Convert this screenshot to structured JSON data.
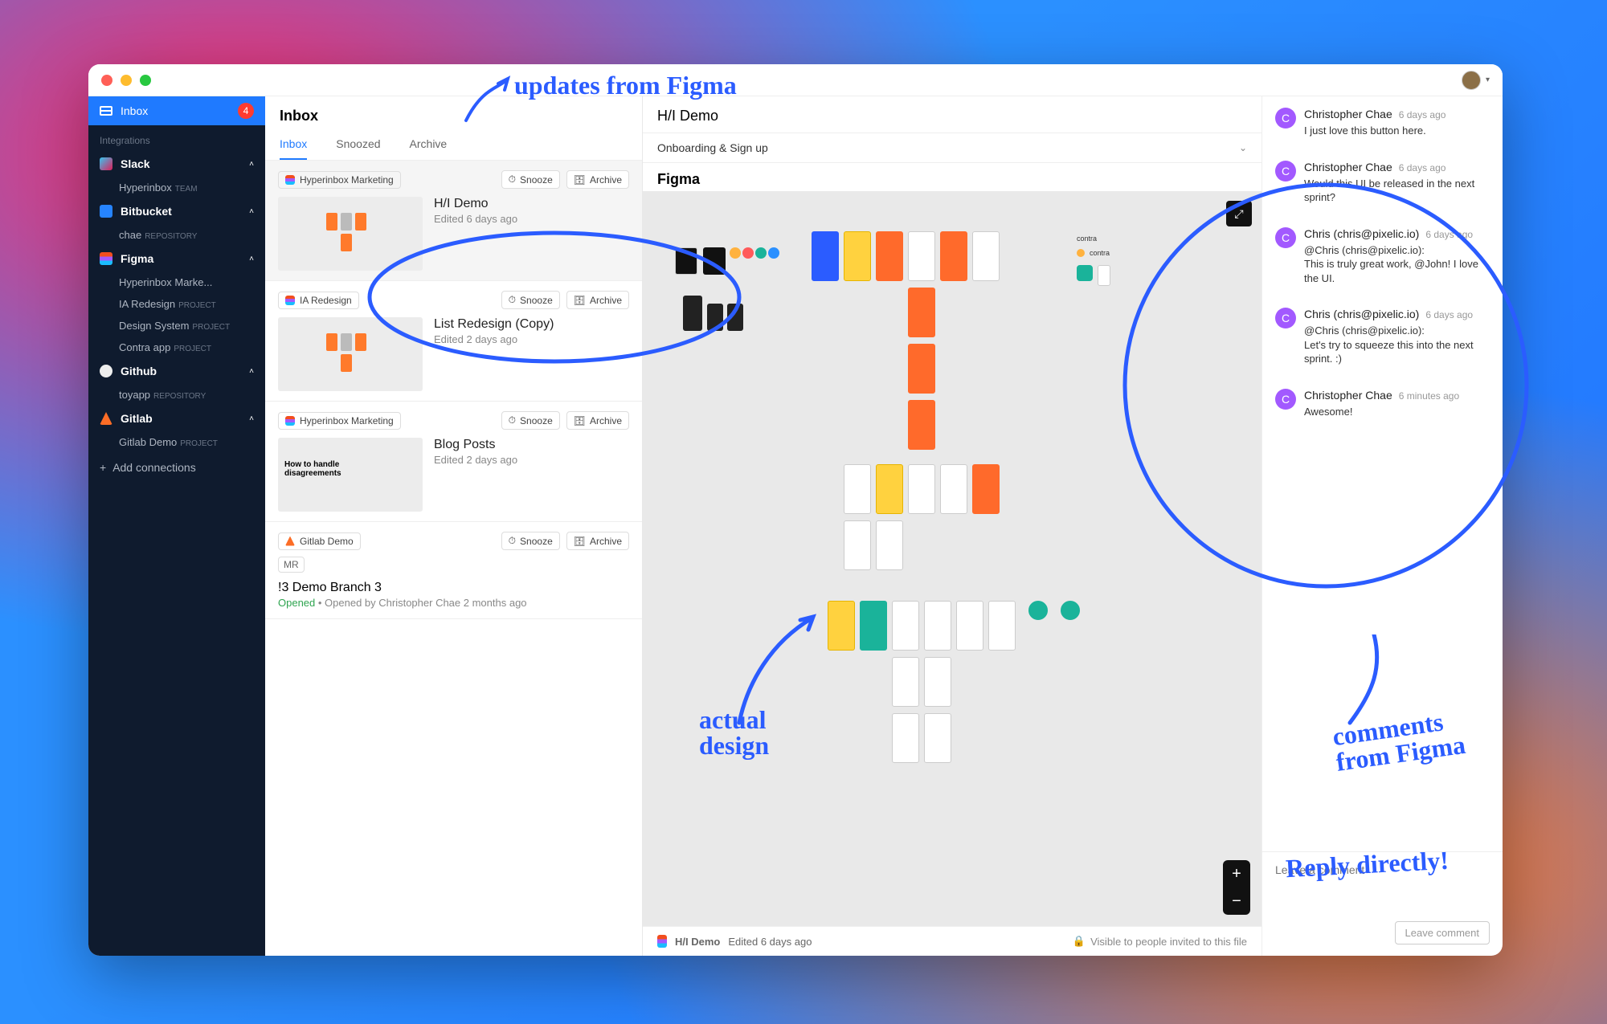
{
  "titlebar": {
    "avatar_caret": "▾"
  },
  "sidebar": {
    "inbox_label": "Inbox",
    "inbox_badge": "4",
    "integrations_label": "Integrations",
    "groups": [
      {
        "icon": "slack",
        "name": "Slack",
        "subs": [
          {
            "label": "Hyperinbox",
            "tag": "TEAM"
          }
        ]
      },
      {
        "icon": "bb",
        "name": "Bitbucket",
        "subs": [
          {
            "label": "chae",
            "tag": "REPOSITORY"
          }
        ]
      },
      {
        "icon": "figma",
        "name": "Figma",
        "subs": [
          {
            "label": "Hyperinbox Marke...",
            "tag": ""
          },
          {
            "label": "IA Redesign",
            "tag": "PROJECT"
          },
          {
            "label": "Design System",
            "tag": "PROJECT"
          },
          {
            "label": "Contra app",
            "tag": "PROJECT"
          }
        ]
      },
      {
        "icon": "gh",
        "name": "Github",
        "subs": [
          {
            "label": "toyapp",
            "tag": "REPOSITORY"
          }
        ]
      },
      {
        "icon": "gl",
        "name": "Gitlab",
        "subs": [
          {
            "label": "Gitlab Demo",
            "tag": "PROJECT"
          }
        ]
      }
    ],
    "add_connections": "Add connections"
  },
  "list": {
    "header": "Inbox",
    "tabs": [
      "Inbox",
      "Snoozed",
      "Archive"
    ],
    "active_tab": 0,
    "snooze_label": "Snooze",
    "archive_label": "Archive",
    "items": [
      {
        "project_icon": "figma",
        "project": "Hyperinbox Marketing",
        "title": "H/I Demo",
        "sub": "Edited 6 days ago"
      },
      {
        "project_icon": "figma",
        "project": "IA Redesign",
        "title": "List Redesign (Copy)",
        "sub": "Edited 2 days ago"
      },
      {
        "project_icon": "figma",
        "project": "Hyperinbox Marketing",
        "title": "Blog Posts",
        "sub": "Edited 2 days ago",
        "thumb_label": "How to handle\ndisagreements"
      },
      {
        "project_icon": "gl",
        "project": "Gitlab Demo",
        "mr_badge": "MR",
        "branch": "!3 Demo Branch 3",
        "meta_status": "Opened",
        "meta_rest": " • Opened by Christopher Chae 2 months ago"
      }
    ]
  },
  "detail": {
    "title": "H/I Demo",
    "section": "Onboarding & Sign up",
    "canvas_title": "Figma",
    "footer_name": "H/I Demo",
    "footer_edited": "Edited 6 days ago",
    "visibility": "Visible to people invited to this file"
  },
  "comments": {
    "items": [
      {
        "initial": "C",
        "name": "Christopher Chae",
        "time": "6 days ago",
        "text": "I just love this button here."
      },
      {
        "initial": "C",
        "name": "Christopher Chae",
        "time": "6 days ago",
        "text": "Would this UI be released in the next sprint?"
      },
      {
        "initial": "C",
        "name": "Chris (chris@pixelic.io)",
        "time": "6 days ago",
        "text": "@Chris (chris@pixelic.io):\nThis is truly great work, @John! I love the UI."
      },
      {
        "initial": "C",
        "name": "Chris (chris@pixelic.io)",
        "time": "6 days ago",
        "text": "@Chris (chris@pixelic.io):\nLet's try to squeeze this into the next sprint. :)"
      },
      {
        "initial": "C",
        "name": "Christopher Chae",
        "time": "6 minutes ago",
        "text": "Awesome!"
      }
    ],
    "input_placeholder": "Leave a comment",
    "leave_button": "Leave comment"
  },
  "annotations": {
    "top": "updates from Figma",
    "left": "actual\ndesign",
    "right": "comments\nfrom Figma",
    "bottom": "Reply directly!"
  }
}
